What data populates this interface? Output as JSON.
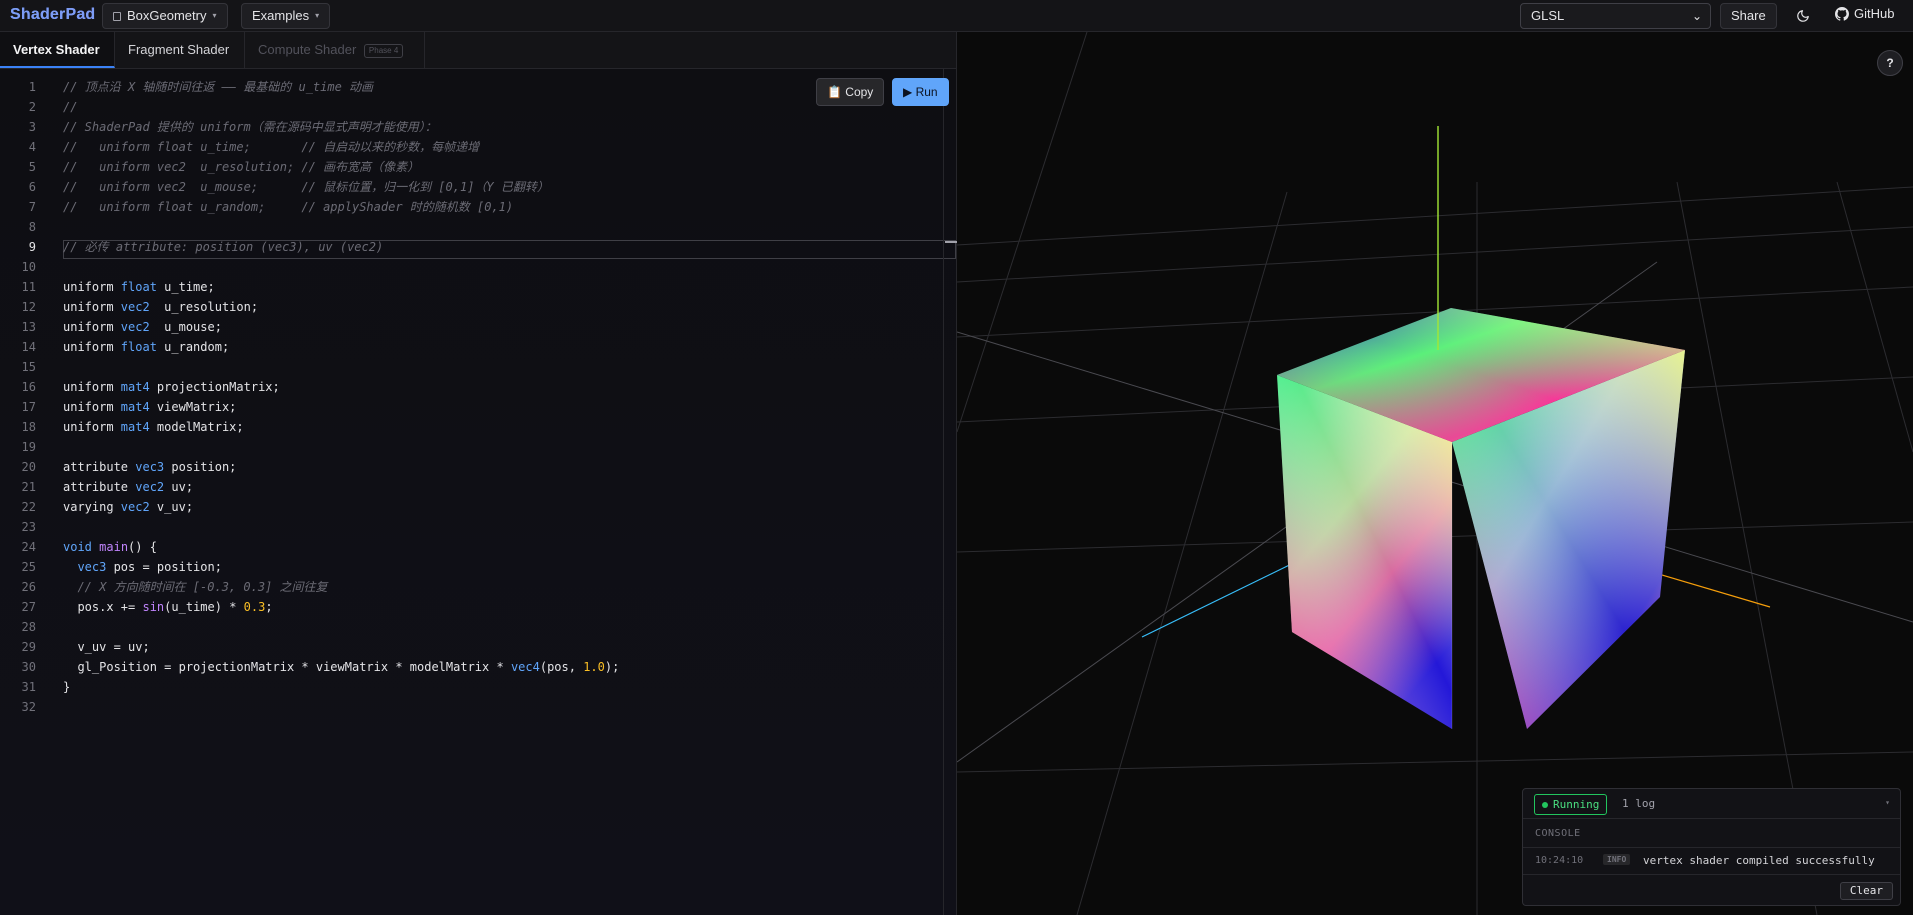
{
  "app": {
    "brand": "ShaderPad",
    "geometry_button": "BoxGeometry",
    "examples_button": "Examples",
    "language_selected": "GLSL",
    "share_label": "Share",
    "github_label": "GitHub",
    "icons": [
      "file-icon",
      "caret-down-icon",
      "chevron-down-icon",
      "moon-icon",
      "github-icon",
      "help-icon",
      "clipboard-icon",
      "play-icon"
    ]
  },
  "tabs": [
    {
      "label": "Vertex Shader",
      "state": "active"
    },
    {
      "label": "Fragment Shader",
      "state": "normal"
    },
    {
      "label": "Compute Shader",
      "badge": "Phase 4",
      "state": "disabled"
    }
  ],
  "editor": {
    "copy_label": "📋 Copy",
    "run_label": "▶ Run",
    "current_line": 9,
    "line_numbers": [
      "1",
      "2",
      "3",
      "4",
      "5",
      "6",
      "7",
      "8",
      "9",
      "10",
      "11",
      "12",
      "13",
      "14",
      "15",
      "16",
      "17",
      "18",
      "19",
      "20",
      "21",
      "22",
      "23",
      "24",
      "25",
      "26",
      "27",
      "28",
      "29",
      "30",
      "31",
      "32"
    ],
    "lines": [
      [
        {
          "t": "c",
          "v": "// 顶点沿 X 轴随时间往返 —— 最基础的 u_time 动画"
        }
      ],
      [
        {
          "t": "c",
          "v": "//"
        }
      ],
      [
        {
          "t": "c",
          "v": "// ShaderPad 提供的 uniform（需在源码中显式声明才能使用）："
        }
      ],
      [
        {
          "t": "c",
          "v": "//   uniform float u_time;       // 自启动以来的秒数，每帧递增"
        }
      ],
      [
        {
          "t": "c",
          "v": "//   uniform vec2  u_resolution; // 画布宽高（像素）"
        }
      ],
      [
        {
          "t": "c",
          "v": "//   uniform vec2  u_mouse;      // 鼠标位置，归一化到 [0,1]（Y 已翻转）"
        }
      ],
      [
        {
          "t": "c",
          "v": "//   uniform float u_random;     // applyShader 时的随机数 [0,1)"
        }
      ],
      [],
      [
        {
          "t": "c",
          "v": "// 必传 attribute: position (vec3), uv (vec2)"
        }
      ],
      [],
      [
        {
          "t": "p",
          "v": "uniform "
        },
        {
          "t": "k",
          "v": "float"
        },
        {
          "t": "p",
          "v": " u_time;"
        }
      ],
      [
        {
          "t": "p",
          "v": "uniform "
        },
        {
          "t": "k",
          "v": "vec2"
        },
        {
          "t": "p",
          "v": "  u_resolution;"
        }
      ],
      [
        {
          "t": "p",
          "v": "uniform "
        },
        {
          "t": "k",
          "v": "vec2"
        },
        {
          "t": "p",
          "v": "  u_mouse;"
        }
      ],
      [
        {
          "t": "p",
          "v": "uniform "
        },
        {
          "t": "k",
          "v": "float"
        },
        {
          "t": "p",
          "v": " u_random;"
        }
      ],
      [],
      [
        {
          "t": "p",
          "v": "uniform "
        },
        {
          "t": "k",
          "v": "mat4"
        },
        {
          "t": "p",
          "v": " projectionMatrix;"
        }
      ],
      [
        {
          "t": "p",
          "v": "uniform "
        },
        {
          "t": "k",
          "v": "mat4"
        },
        {
          "t": "p",
          "v": " viewMatrix;"
        }
      ],
      [
        {
          "t": "p",
          "v": "uniform "
        },
        {
          "t": "k",
          "v": "mat4"
        },
        {
          "t": "p",
          "v": " modelMatrix;"
        }
      ],
      [],
      [
        {
          "t": "p",
          "v": "attribute "
        },
        {
          "t": "k",
          "v": "vec3"
        },
        {
          "t": "p",
          "v": " position;"
        }
      ],
      [
        {
          "t": "p",
          "v": "attribute "
        },
        {
          "t": "k",
          "v": "vec2"
        },
        {
          "t": "p",
          "v": " uv;"
        }
      ],
      [
        {
          "t": "p",
          "v": "varying "
        },
        {
          "t": "k",
          "v": "vec2"
        },
        {
          "t": "p",
          "v": " v_uv;"
        }
      ],
      [],
      [
        {
          "t": "k",
          "v": "void"
        },
        {
          "t": "p",
          "v": " "
        },
        {
          "t": "f",
          "v": "main"
        },
        {
          "t": "p",
          "v": "() {"
        }
      ],
      [
        {
          "t": "p",
          "v": "  "
        },
        {
          "t": "k",
          "v": "vec3"
        },
        {
          "t": "p",
          "v": " pos = position;"
        }
      ],
      [
        {
          "t": "p",
          "v": "  "
        },
        {
          "t": "c",
          "v": "// X 方向随时间在 [-0.3, 0.3] 之间往复"
        }
      ],
      [
        {
          "t": "p",
          "v": "  pos.x += "
        },
        {
          "t": "f",
          "v": "sin"
        },
        {
          "t": "p",
          "v": "(u_time) * "
        },
        {
          "t": "n",
          "v": "0.3"
        },
        {
          "t": "p",
          "v": ";"
        }
      ],
      [],
      [
        {
          "t": "p",
          "v": "  v_uv = uv;"
        }
      ],
      [
        {
          "t": "p",
          "v": "  gl_Position = projectionMatrix * viewMatrix * modelMatrix * "
        },
        {
          "t": "k",
          "v": "vec4"
        },
        {
          "t": "p",
          "v": "(pos, "
        },
        {
          "t": "n",
          "v": "1.0"
        },
        {
          "t": "p",
          "v": ");"
        }
      ],
      [
        {
          "t": "p",
          "v": "}"
        }
      ],
      []
    ]
  },
  "viewport": {
    "help_label": "?"
  },
  "console": {
    "status": "Running",
    "log_count": "1 log",
    "title": "CONSOLE",
    "entries": [
      {
        "time": "10:24:10",
        "level": "INFO",
        "message": "vertex shader compiled successfully"
      }
    ],
    "clear_label": "Clear"
  },
  "colors": {
    "accent": "#60a5fa",
    "brand_start": "#60a5fa",
    "brand_end": "#a78bfa",
    "running": "#22c55e",
    "keyword": "#60a5fa",
    "function": "#c084fc",
    "number": "#fbbf24",
    "comment": "#6b6b75",
    "axis_y": "#a3e635",
    "axis_x": "#f59e0b",
    "axis_z": "#38bdf8"
  }
}
